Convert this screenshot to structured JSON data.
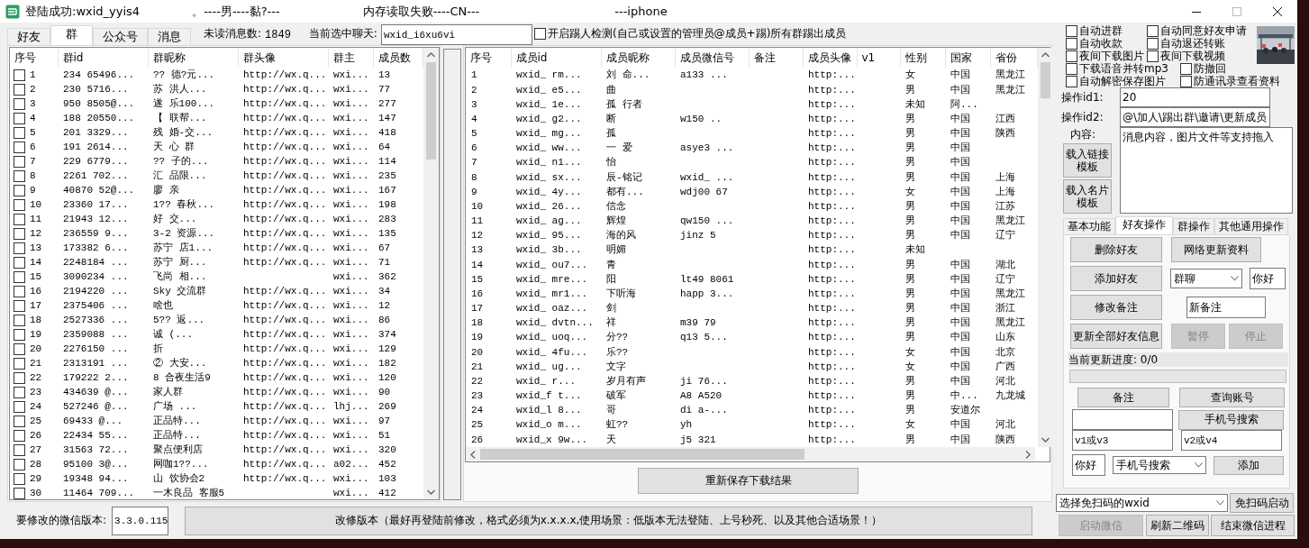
{
  "window": {
    "title_parts": [
      "登陆成功:wxid_yyis4",
      "。----男----黏?---",
      "内存读取失败----CN---",
      "---iphone"
    ]
  },
  "tabs": [
    {
      "label": "好友",
      "selected": false
    },
    {
      "label": "群",
      "selected": true
    },
    {
      "label": "公众号",
      "selected": false
    },
    {
      "label": "消息",
      "selected": false
    }
  ],
  "unread": {
    "label": "未读消息数:",
    "value": "1849"
  },
  "current_chat": {
    "label": "当前选中聊天:",
    "value": "wxid_i6xu6vi"
  },
  "kick_detect": {
    "label": "开启踢人检测(自己或设置的管理员@成员+踢)所有群踢出成员",
    "checked": false
  },
  "groups_table": {
    "columns": [
      "序号",
      "群id",
      "群昵称",
      "群头像",
      "群主",
      "成员数"
    ],
    "rows": [
      {
        "checked": false,
        "no": "1",
        "id": "234 65496...",
        "nick": "?? 德?元...",
        "avatar": "http://wx.q...",
        "owner": "wxi...",
        "members": "13"
      },
      {
        "checked": false,
        "no": "2",
        "id": "230 5716...",
        "nick": "苏 洪人...",
        "avatar": "http://wx.q...",
        "owner": "wxi...",
        "members": "77"
      },
      {
        "checked": false,
        "no": "3",
        "id": "950 8505@...",
        "nick": "遂 乐100...",
        "avatar": "http://wx.q...",
        "owner": "wxi...",
        "members": "277"
      },
      {
        "checked": false,
        "no": "4",
        "id": "188 20550...",
        "nick": "【 联帮...",
        "avatar": "http://wx.q...",
        "owner": "wxi...",
        "members": "147"
      },
      {
        "checked": false,
        "no": "5",
        "id": "201 3329...",
        "nick": "残 婚-交...",
        "avatar": "http://wx.q...",
        "owner": "wxi...",
        "members": "418"
      },
      {
        "checked": false,
        "no": "6",
        "id": "191 2614...",
        "nick": "天 心 群",
        "avatar": "http://wx.q...",
        "owner": "wxi...",
        "members": "64"
      },
      {
        "checked": false,
        "no": "7",
        "id": "229 6779...",
        "nick": "?? 子的...",
        "avatar": "http://wx.q...",
        "owner": "wxi...",
        "members": "114"
      },
      {
        "checked": false,
        "no": "8",
        "id": "2261 702...",
        "nick": "汇 品限...",
        "avatar": "http://wx.q...",
        "owner": "wxi...",
        "members": "235"
      },
      {
        "checked": false,
        "no": "9",
        "id": "40870 52@...",
        "nick": "廖 亲",
        "avatar": "http://wx.q...",
        "owner": "wxi...",
        "members": "167"
      },
      {
        "checked": false,
        "no": "10",
        "id": "23360 17...",
        "nick": "1?? 春秋...",
        "avatar": "http://wx.q...",
        "owner": "wxi...",
        "members": "198"
      },
      {
        "checked": false,
        "no": "11",
        "id": "21943 12...",
        "nick": "好 交...",
        "avatar": "http://wx.q...",
        "owner": "wxi...",
        "members": "283"
      },
      {
        "checked": false,
        "no": "12",
        "id": "236559 9...",
        "nick": "3-2 资源...",
        "avatar": "http://wx.q...",
        "owner": "wxi...",
        "members": "135"
      },
      {
        "checked": false,
        "no": "13",
        "id": "173382 6...",
        "nick": "苏宁 店1...",
        "avatar": "http://wx.q...",
        "owner": "wxi...",
        "members": "67"
      },
      {
        "checked": false,
        "no": "14",
        "id": "2248184 ...",
        "nick": "苏宁 厨...",
        "avatar": "http://wx.q...",
        "owner": "wxi...",
        "members": "71"
      },
      {
        "checked": false,
        "no": "15",
        "id": "3090234 ...",
        "nick": "飞尚 相...",
        "owner": "wxi...",
        "members": "362"
      },
      {
        "checked": false,
        "no": "16",
        "id": "2194220 ...",
        "nick": "Sky 交流群",
        "avatar": "http://wx.q...",
        "owner": "wxi...",
        "members": "34"
      },
      {
        "checked": false,
        "no": "17",
        "id": "2375406 ...",
        "nick": "啥也",
        "avatar": "http://wx.q...",
        "owner": "wxi...",
        "members": "12"
      },
      {
        "checked": false,
        "no": "18",
        "id": "2527336 ...",
        "nick": "5?? 返...",
        "avatar": "http://wx.q...",
        "owner": "wxi...",
        "members": "86"
      },
      {
        "checked": false,
        "no": "19",
        "id": "2359088 ...",
        "nick": "诚 (...",
        "avatar": "http://wx.q...",
        "owner": "wxi...",
        "members": "374"
      },
      {
        "checked": false,
        "no": "20",
        "id": "2276150 ...",
        "nick": "折",
        "avatar": "http://wx.q...",
        "owner": "wxi...",
        "members": "129"
      },
      {
        "checked": false,
        "no": "21",
        "id": "2313191 ...",
        "nick": "② 大安...",
        "avatar": "http://wx.q...",
        "owner": "wxi...",
        "members": "182"
      },
      {
        "checked": false,
        "no": "22",
        "id": "179222 2...",
        "nick": "8 合夜生活9",
        "avatar": "http://wx.q...",
        "owner": "wxi...",
        "members": "120"
      },
      {
        "checked": false,
        "no": "23",
        "id": "434639 @...",
        "nick": "家人群",
        "avatar": "http://wx.q...",
        "owner": "wxi...",
        "members": "90"
      },
      {
        "checked": false,
        "no": "24",
        "id": "527246 @...",
        "nick": "广场 ...",
        "avatar": "http://wx.q...",
        "owner": "lhj...",
        "members": "269"
      },
      {
        "checked": false,
        "no": "25",
        "id": "69433 @...",
        "nick": "正品特...",
        "avatar": "http://wx.q...",
        "owner": "wxi...",
        "members": "97"
      },
      {
        "checked": false,
        "no": "26",
        "id": "22434 55...",
        "nick": "正品特...",
        "avatar": "http://wx.q...",
        "owner": "wxi...",
        "members": "51"
      },
      {
        "checked": false,
        "no": "27",
        "id": "31563 72...",
        "nick": "聚点便利店",
        "avatar": "http://wx.q...",
        "owner": "wxi...",
        "members": "320"
      },
      {
        "checked": false,
        "no": "28",
        "id": "95100 3@...",
        "nick": "网咖1??...",
        "avatar": "http://wx.q...",
        "owner": "a02...",
        "members": "452"
      },
      {
        "checked": false,
        "no": "29",
        "id": "19348 94...",
        "nick": "山 饮协会2",
        "avatar": "http://wx.q...",
        "owner": "wxi...",
        "members": "103"
      },
      {
        "checked": false,
        "no": "30",
        "id": "11464 709...",
        "nick": "一木良品 客服5",
        "owner": "wxi...",
        "members": "412"
      }
    ]
  },
  "members_table": {
    "columns": [
      "序号",
      "成员id",
      "成员昵称",
      "成员微信号",
      "备注",
      "成员头像",
      "v1",
      "性别",
      "国家",
      "省份"
    ],
    "rows": [
      {
        "no": "1",
        "id": "wxid_ rm...",
        "nick": "刘 命...",
        "wxno": "a133 ...",
        "avatar": "http:...",
        "sex": "女",
        "country": "中国",
        "province": "黑龙江"
      },
      {
        "no": "2",
        "id": "wxid_ e5...",
        "nick": "曲",
        "avatar": "http:...",
        "sex": "男",
        "country": "中国",
        "province": "黑龙江"
      },
      {
        "no": "3",
        "id": "wxid_ 1e...",
        "nick": "孤 行者",
        "avatar": "http:...",
        "sex": "未知",
        "country": "阿..."
      },
      {
        "no": "4",
        "id": "wxid_ g2...",
        "nick": "断",
        "wxno": "w150 ..",
        "avatar": "http:...",
        "sex": "男",
        "country": "中国",
        "province": "江西"
      },
      {
        "no": "5",
        "id": "wxid_ mg...",
        "nick": "孤",
        "avatar": "http:...",
        "sex": "男",
        "country": "中国",
        "province": "陕西"
      },
      {
        "no": "6",
        "id": "wxid_ ww...",
        "nick": "一 爱",
        "wxno": "asye3 ...",
        "avatar": "http:...",
        "sex": "男",
        "country": "中国"
      },
      {
        "no": "7",
        "id": "wxid_ n1...",
        "nick": "怡",
        "avatar": "http:...",
        "sex": "男",
        "country": "中国"
      },
      {
        "no": "8",
        "id": "wxid_ sx...",
        "nick": "辰-铭记",
        "wxno": "wxid_ ...",
        "avatar": "http:...",
        "sex": "男",
        "country": "中国",
        "province": "上海"
      },
      {
        "no": "9",
        "id": "wxid_ 4y...",
        "nick": "都有...",
        "wxno": "wdj00 67",
        "avatar": "http:...",
        "sex": "女",
        "country": "中国",
        "province": "上海"
      },
      {
        "no": "10",
        "id": "wxid_ 26...",
        "nick": "信念",
        "avatar": "http:...",
        "sex": "男",
        "country": "中国",
        "province": "江苏"
      },
      {
        "no": "11",
        "id": "wxid_ ag...",
        "nick": "辉煌",
        "wxno": "qw150 ...",
        "avatar": "http:...",
        "sex": "男",
        "country": "中国",
        "province": "黑龙江"
      },
      {
        "no": "12",
        "id": "wxid_ 95...",
        "nick": "海的风",
        "wxno": "jinz 5",
        "avatar": "http:...",
        "sex": "男",
        "country": "中国",
        "province": "辽宁"
      },
      {
        "no": "13",
        "id": "wxid_ 3b...",
        "nick": "明媚",
        "avatar": "http:...",
        "sex": "未知"
      },
      {
        "no": "14",
        "id": "wxid_ ou7...",
        "nick": "青",
        "avatar": "http:...",
        "sex": "男",
        "country": "中国",
        "province": "湖北"
      },
      {
        "no": "15",
        "id": "wxid_ mre...",
        "nick": "阳",
        "wxno": "lt49 8061",
        "avatar": "http:...",
        "sex": "男",
        "country": "中国",
        "province": "辽宁"
      },
      {
        "no": "16",
        "id": "wxid_ mr1...",
        "nick": "下听海",
        "wxno": "happ 3...",
        "avatar": "http:...",
        "sex": "男",
        "country": "中国",
        "province": "黑龙江"
      },
      {
        "no": "17",
        "id": "wxid_ oaz...",
        "nick": "剑",
        "avatar": "http:...",
        "sex": "男",
        "country": "中国",
        "province": "浙江"
      },
      {
        "no": "18",
        "id": "wxid_ dvtn...",
        "nick": "祥",
        "wxno": "m39 79",
        "avatar": "http:...",
        "sex": "男",
        "country": "中国",
        "province": "黑龙江"
      },
      {
        "no": "19",
        "id": "wxid_ uoq...",
        "nick": "分??",
        "wxno": "q13 5...",
        "avatar": "http:...",
        "sex": "男",
        "country": "中国",
        "province": "山东"
      },
      {
        "no": "20",
        "id": "wxid_ 4fu...",
        "nick": "乐??",
        "avatar": "http:...",
        "sex": "女",
        "country": "中国",
        "province": "北京"
      },
      {
        "no": "21",
        "id": "wxid_ ug...",
        "nick": "文字",
        "avatar": "http:...",
        "sex": "女",
        "country": "中国",
        "province": "广西"
      },
      {
        "no": "22",
        "id": "wxid_ r...",
        "nick": "岁月有声",
        "wxno": "ji 76...",
        "avatar": "http:...",
        "sex": "男",
        "country": "中国",
        "province": "河北"
      },
      {
        "no": "23",
        "id": "wxid_f t...",
        "nick": "破军",
        "wxno": "A8 A520",
        "avatar": "http:...",
        "sex": "男",
        "country": "中...",
        "province": "九龙城"
      },
      {
        "no": "24",
        "id": "wxid_l 8...",
        "nick": "哥",
        "wxno": "di a-...",
        "avatar": "http:...",
        "sex": "男",
        "country": "安道尔"
      },
      {
        "no": "25",
        "id": "wxid_o m...",
        "nick": "虹??",
        "wxno": "yh",
        "avatar": "http:...",
        "sex": "女",
        "country": "中国",
        "province": "河北"
      },
      {
        "no": "26",
        "id": "wxid_x 9w...",
        "nick": "天",
        "wxno": "j5 321",
        "avatar": "http:...",
        "sex": "男",
        "country": "中国",
        "province": "陕西"
      }
    ]
  },
  "resave_button": "重新保存下载结果",
  "version": {
    "label": "要修改的微信版本:",
    "value": "3.3.0.115",
    "button": "改修版本（最好再登陆前修改，格式必须为x.x.x.x,使用场景：低版本无法登陆、上号秒死、以及其他合适场景！）"
  },
  "options": [
    [
      {
        "label": "自动进群",
        "checked": false
      },
      {
        "label": "自动同意好友申请",
        "checked": false
      }
    ],
    [
      {
        "label": "自动收款",
        "checked": false
      },
      {
        "label": "自动退还转账",
        "checked": false
      }
    ],
    [
      {
        "label": "夜间下载图片",
        "checked": false
      },
      {
        "label": "夜间下载视频",
        "checked": false
      }
    ],
    [
      {
        "label": "下载语音并转mp3",
        "checked": false
      },
      {
        "label": "防撤回",
        "checked": false
      }
    ],
    [
      {
        "label": "自动解密保存图片",
        "checked": false
      },
      {
        "label": "防通讯录查看资料",
        "checked": false
      }
    ]
  ],
  "op_fields": [
    {
      "label": "操作id1:",
      "value": "20"
    },
    {
      "label": "操作id2:",
      "value": "@\\加人\\踢出群\\邀请\\更新成员"
    }
  ],
  "content": {
    "label": "内容:",
    "value": "消息内容，图片文件等支持拖入"
  },
  "template_buttons": [
    "载入链接模板",
    "载入名片模板"
  ],
  "right_tabs": [
    {
      "label": "基本功能",
      "selected": false
    },
    {
      "label": "好友操作",
      "selected": true
    },
    {
      "label": "群操作",
      "selected": false
    },
    {
      "label": "其他通用操作",
      "selected": false
    }
  ],
  "friend_ops": {
    "delete_friend": {
      "label": "删除好友",
      "disabled": false
    },
    "refresh_info": {
      "label": "网络更新资料",
      "disabled": false
    },
    "add_friend": {
      "label": "添加好友",
      "disabled": false
    },
    "add_source": {
      "value": "群聊"
    },
    "greeting": {
      "value": "你好"
    },
    "edit_note": {
      "label": "修改备注",
      "disabled": false
    },
    "new_note": {
      "value": "新备注"
    },
    "update_all": {
      "label": "更新全部好友信息",
      "disabled": false
    },
    "pause": {
      "label": "暂停",
      "disabled": true
    },
    "stop": {
      "label": "停止",
      "disabled": true
    },
    "progress_label": "当前更新进度: 0/0",
    "progress": {
      "level": 0
    },
    "note": {
      "label": "备注",
      "disabled": false
    },
    "query": {
      "label": "查询账号",
      "disabled": false
    },
    "phone_search": {
      "label": "手机号搜索",
      "disabled": false
    },
    "v1v3": {
      "value": "v1或v3"
    },
    "v2v4": {
      "value": "v2或v4"
    },
    "hello": {
      "value": "你好"
    },
    "search_mode": {
      "value": "手机号搜索"
    },
    "add": {
      "label": "添加",
      "disabled": false
    }
  },
  "bottom": {
    "wxid_select": {
      "value": "选择免扫码的wxid"
    },
    "auto_start": {
      "label": "免扫码启动",
      "disabled": false
    },
    "launch": {
      "label": "启动微信",
      "disabled": true
    },
    "refresh_qr": {
      "label": "刷新二维码",
      "disabled": false
    },
    "kill": {
      "label": "结束微信进程",
      "disabled": false
    }
  }
}
